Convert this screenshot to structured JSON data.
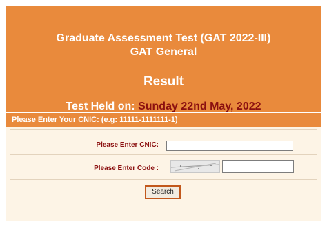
{
  "header": {
    "title_line1": "Graduate Assessment Test (GAT 2022-III)",
    "title_line2": "GAT General",
    "result_label": "Result",
    "held_label": "Test Held on:",
    "held_date": "Sunday 22nd May, 2022"
  },
  "cnic_bar": {
    "text": "Please Enter Your CNIC: (e.g: 11111-1111111-1)"
  },
  "form": {
    "cnic_label": "Please Enter CNIC:",
    "cnic_value": "",
    "code_label": "Please Enter Code :",
    "code_value": "",
    "search_label": "Search"
  },
  "colors": {
    "header_bg": "#e98a3c",
    "date_text": "#8b1010",
    "label_text": "#8b1010",
    "form_bg": "#fdf4e6"
  }
}
